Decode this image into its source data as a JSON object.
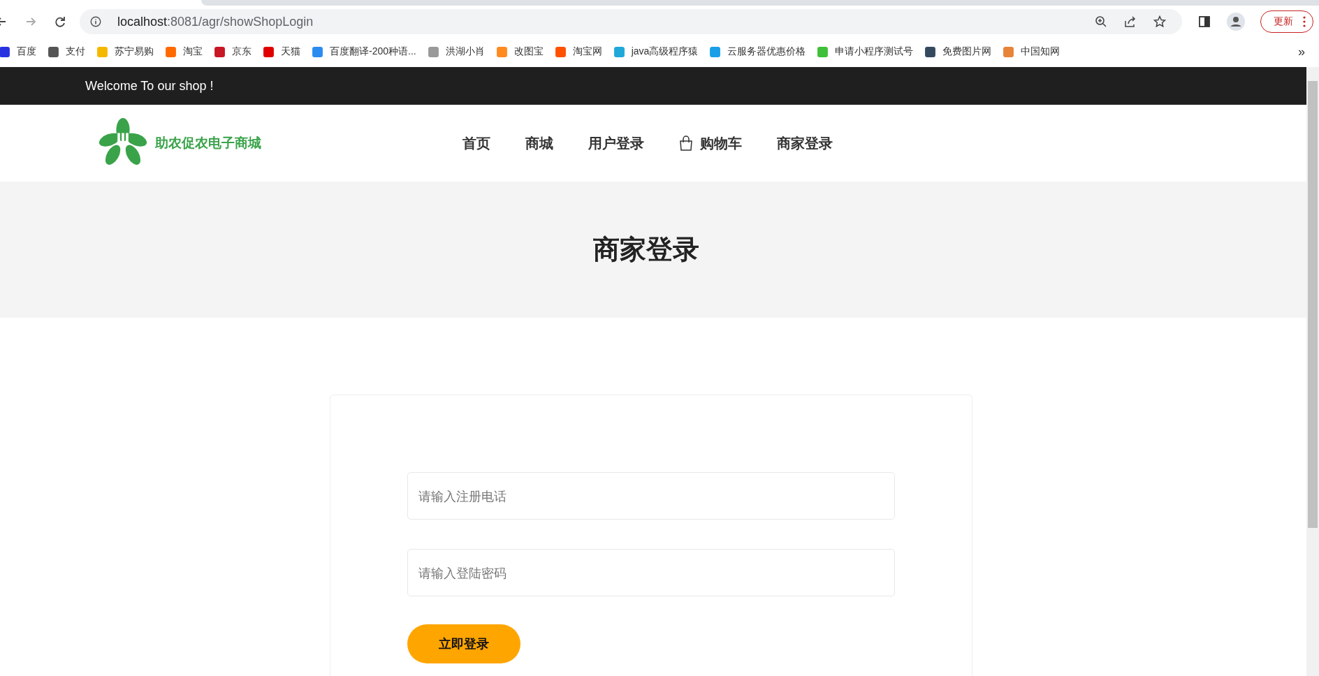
{
  "browser": {
    "url_host": "localhost",
    "url_path": ":8081/agr/showShopLogin",
    "update_button": "更新"
  },
  "bookmarks": [
    {
      "label": "百度",
      "color": "#2932e1"
    },
    {
      "label": "支付",
      "color": "#555555"
    },
    {
      "label": "苏宁易购",
      "color": "#f5b800"
    },
    {
      "label": "淘宝",
      "color": "#ff6a00"
    },
    {
      "label": "京东",
      "color": "#c81623"
    },
    {
      "label": "天猫",
      "color": "#e00000"
    },
    {
      "label": "百度翻译-200种语...",
      "color": "#2a8cf0"
    },
    {
      "label": "洪湖小肖",
      "color": "#999999"
    },
    {
      "label": "改图宝",
      "color": "#ff8a1f"
    },
    {
      "label": "淘宝网",
      "color": "#ff5000"
    },
    {
      "label": "java高级程序猿",
      "color": "#20a8d8"
    },
    {
      "label": "云服务器优惠价格",
      "color": "#1a9ee8"
    },
    {
      "label": "申请小程序测试号",
      "color": "#3fbf3a"
    },
    {
      "label": "免费图片网",
      "color": "#34495e"
    },
    {
      "label": "中国知网",
      "color": "#e8833a"
    }
  ],
  "bookmarks_more": "»",
  "topbar": {
    "welcome": "Welcome To our shop !"
  },
  "header": {
    "logo_text": "助农促农电子商城",
    "nav": [
      {
        "label": "首页",
        "kind": "link"
      },
      {
        "label": "商城",
        "kind": "link"
      },
      {
        "label": "用户登录",
        "kind": "link"
      },
      {
        "label": "购物车",
        "kind": "cart"
      },
      {
        "label": "商家登录",
        "kind": "link"
      }
    ]
  },
  "banner": {
    "title": "商家登录"
  },
  "form": {
    "fields": [
      {
        "placeholder": "请输入注册电话"
      },
      {
        "placeholder": "请输入登陆密码"
      }
    ],
    "submit": "立即登录"
  }
}
